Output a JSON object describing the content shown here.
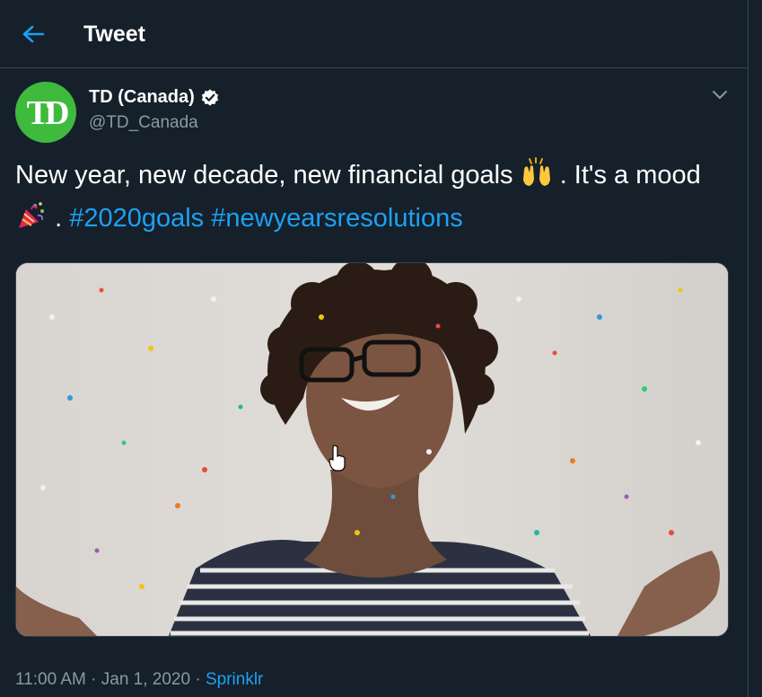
{
  "header": {
    "title": "Tweet",
    "back_icon": "arrow-left-icon"
  },
  "author": {
    "avatar_text": "TD",
    "display_name": "TD (Canada)",
    "handle": "@TD_Canada",
    "verified_icon": "verified-badge-icon"
  },
  "tweet": {
    "text_part1": "New year, new decade, new financial goals",
    "emoji1": "raising-hands-icon",
    "text_part2": ". It's a mood",
    "emoji2": "party-popper-icon",
    "text_part3": ". ",
    "hashtag1": "#2020goals",
    "space": " ",
    "hashtag2": "#newyearsresolutions"
  },
  "meta": {
    "time": "11:00 AM",
    "sep1": " · ",
    "date": "Jan 1, 2020",
    "sep2": " · ",
    "source": "Sprinklr"
  },
  "colors": {
    "background": "#15202b",
    "border": "#38444d",
    "accent": "#1da1f2",
    "secondary_text": "#8899a6",
    "td_green": "#3fba3c"
  }
}
